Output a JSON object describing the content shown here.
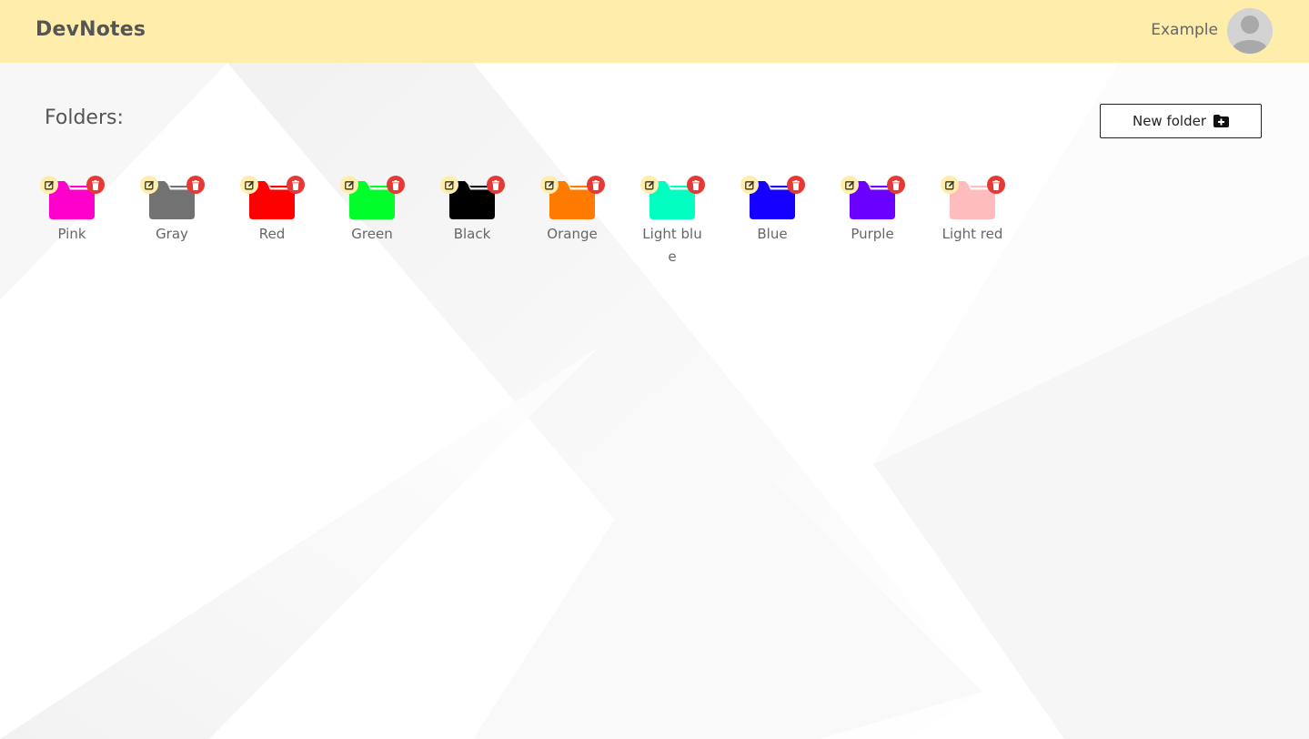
{
  "header": {
    "brand": "DevNotes",
    "username": "Example",
    "background_color": "#ffeeab"
  },
  "main": {
    "title": "Folders:",
    "new_folder_label": "New folder",
    "new_folder_icon": "folder-plus-icon"
  },
  "folder_actions": {
    "edit_icon": "edit-icon",
    "delete_icon": "trash-icon",
    "edit_color": "#ffeeab",
    "delete_color": "#e53935"
  },
  "folders": [
    {
      "label": "Pink",
      "color": "#ff00cc"
    },
    {
      "label": "Gray",
      "color": "#727272"
    },
    {
      "label": "Red",
      "color": "#ff0000"
    },
    {
      "label": "Green",
      "color": "#00ff2a"
    },
    {
      "label": "Black",
      "color": "#000000"
    },
    {
      "label": "Orange",
      "color": "#ff7b00"
    },
    {
      "label": "Light blue",
      "color": "#00ffc0"
    },
    {
      "label": "Blue",
      "color": "#1500ff"
    },
    {
      "label": "Purple",
      "color": "#6a00ff"
    },
    {
      "label": "Light red",
      "color": "#ffbcbc"
    }
  ]
}
